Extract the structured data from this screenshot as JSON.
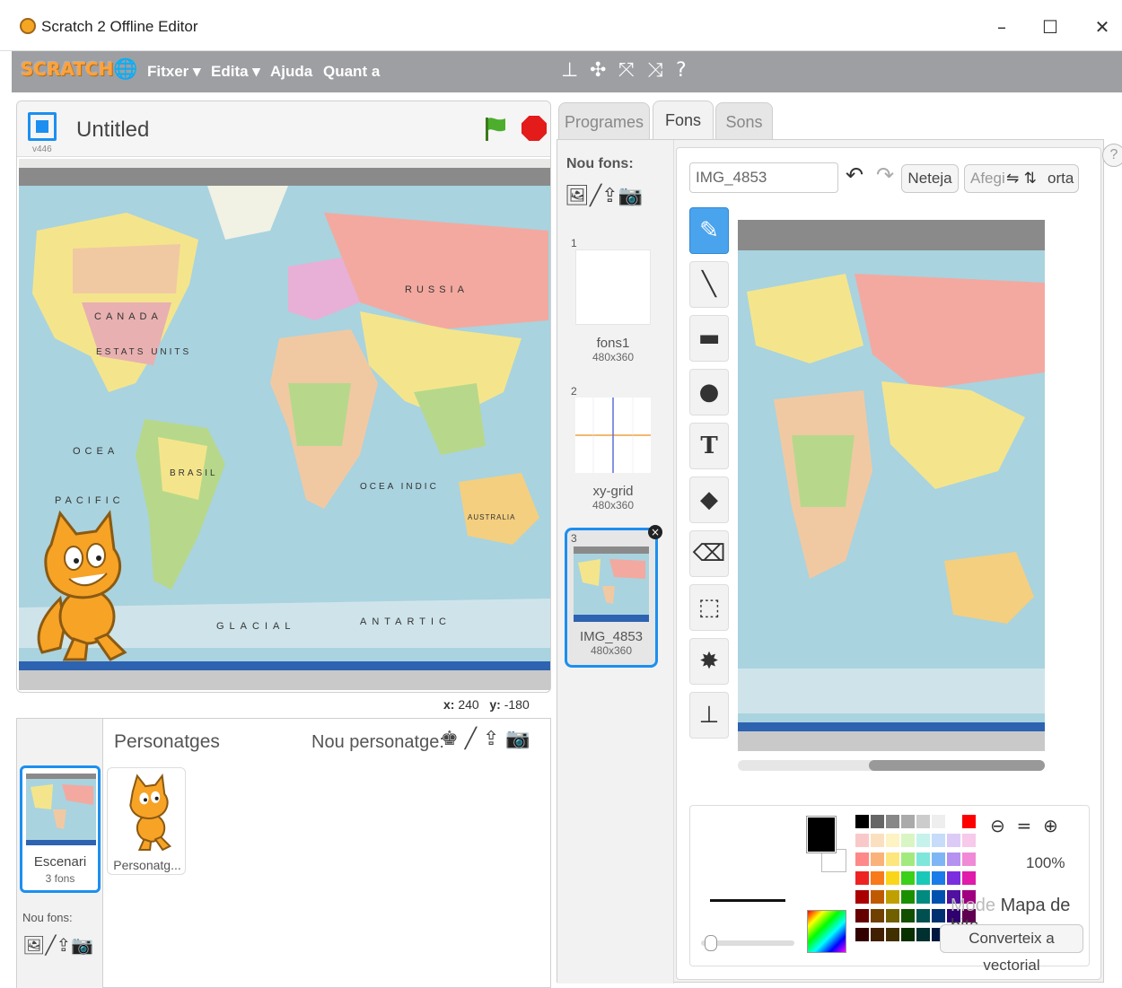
{
  "window": {
    "title": "Scratch 2 Offline Editor",
    "minimize": "–",
    "maximize": "☐",
    "close": "✕"
  },
  "menubar": {
    "logo": "SCRATCH",
    "items": [
      "Fitxer ▾",
      "Edita ▾",
      "Ajuda",
      "Quant a"
    ],
    "tools": [
      "stamp-icon",
      "grow-icon",
      "shrink-icon",
      "expand-icon",
      "help-icon"
    ]
  },
  "stage": {
    "version": "v446",
    "title": "Untitled",
    "coords": {
      "x_label": "x:",
      "x": "240",
      "y_label": "y:",
      "y": "-180"
    }
  },
  "sprites": {
    "title": "Personatges",
    "new_sprite_label": "Nou personatge:",
    "stage_name": "Escenari",
    "stage_count": "3 fons",
    "new_bg_label": "Nou fons:",
    "sprite_name": "Personatg..."
  },
  "tabs": [
    "Programes",
    "Fons",
    "Sons"
  ],
  "costumes": {
    "new_label": "Nou fons:",
    "items": [
      {
        "num": "1",
        "name": "fons1",
        "size": "480x360"
      },
      {
        "num": "2",
        "name": "xy-grid",
        "size": "480x360"
      },
      {
        "num": "3",
        "name": "IMG_4853",
        "size": "480x360"
      }
    ]
  },
  "editor": {
    "name_value": "IMG_4853",
    "clear": "Neteja",
    "import_partial": "Afegi",
    "import_suffix": "orta",
    "zoom": "100%",
    "mode_partial": "Mode",
    "mode": "Mapa de bits",
    "convert": "Converteix a vectorial"
  },
  "map_labels": [
    "RUSSIA",
    "CANADA",
    "ESTATS UNITS",
    "OCEA",
    "PACIFIC",
    "BRASIL",
    "AUSTRALIA",
    "OCEA INDIC",
    "ANTARTIC",
    "GLACIAL"
  ]
}
